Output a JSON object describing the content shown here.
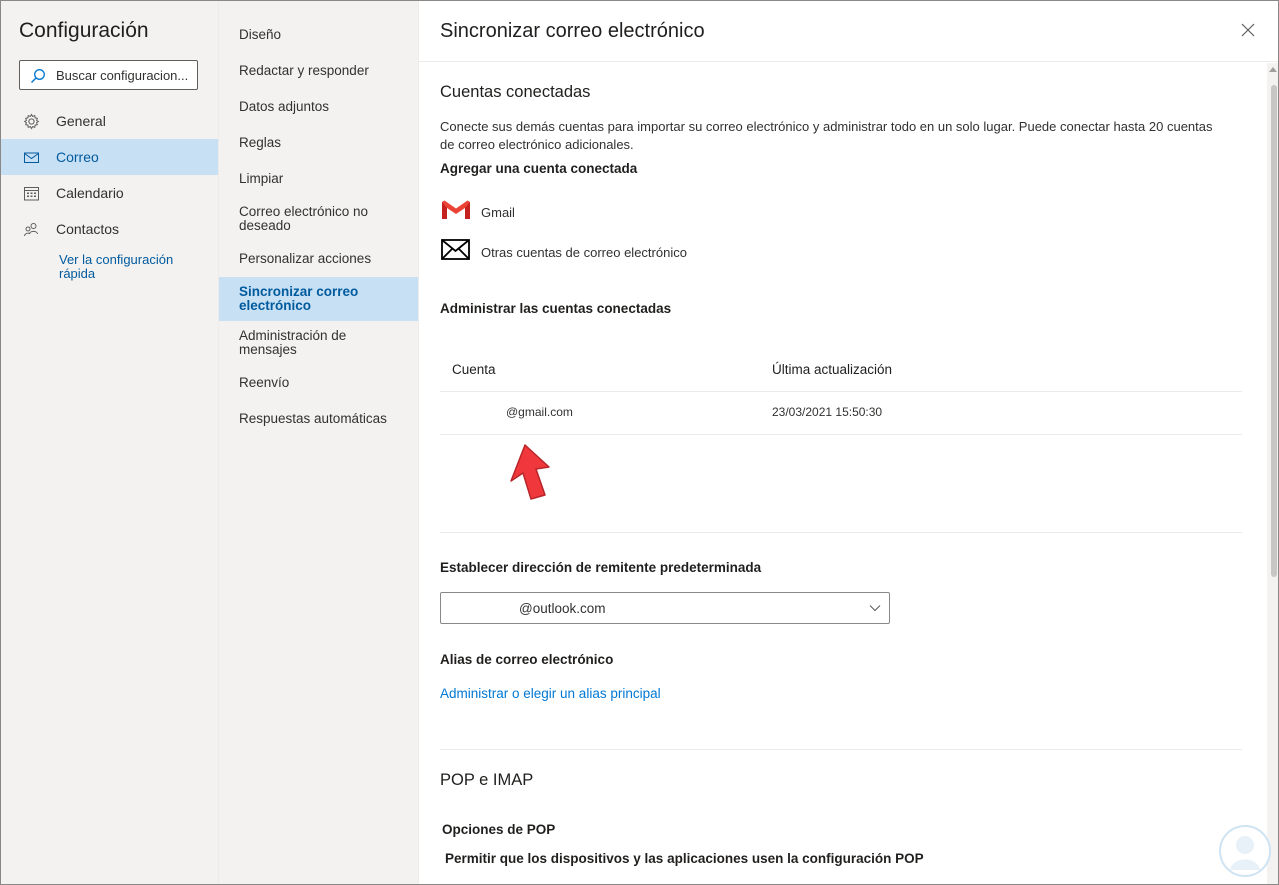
{
  "nav": {
    "title": "Configuración",
    "search_placeholder": "Buscar configuracion...",
    "items": [
      {
        "label": "General",
        "icon": "gear-icon"
      },
      {
        "label": "Correo",
        "icon": "mail-icon",
        "active": true
      },
      {
        "label": "Calendario",
        "icon": "calendar-icon"
      },
      {
        "label": "Contactos",
        "icon": "people-icon"
      }
    ],
    "quick_link": "Ver la configuración rápida"
  },
  "submenu": {
    "items": [
      "Diseño",
      "Redactar y responder",
      "Datos adjuntos",
      "Reglas",
      "Limpiar",
      "Correo electrónico no deseado",
      "Personalizar acciones",
      "Sincronizar correo electrónico",
      "Administración de mensajes",
      "Reenvío",
      "Respuestas automáticas"
    ],
    "active_index": 7
  },
  "panel": {
    "title": "Sincronizar correo electrónico",
    "connected": {
      "heading": "Cuentas conectadas",
      "description": "Conecte sus demás cuentas para importar su correo electrónico y administrar todo en un solo lugar. Puede conectar hasta 20 cuentas de correo electrónico adicionales.",
      "add_label": "Agregar una cuenta conectada",
      "gmail_label": "Gmail",
      "other_label": "Otras cuentas de correo electrónico",
      "manage_label": "Administrar las cuentas conectadas",
      "col_account": "Cuenta",
      "col_updated": "Última actualización",
      "rows": [
        {
          "account": "@gmail.com",
          "updated": "23/03/2021 15:50:30"
        }
      ]
    },
    "sender": {
      "label": "Establecer dirección de remitente predeterminada",
      "value": "@outlook.com"
    },
    "alias": {
      "label": "Alias de correo electrónico",
      "link": "Administrar o elegir un alias principal"
    },
    "pop": {
      "heading": "POP e IMAP",
      "options_label": "Opciones de POP",
      "allow_label": "Permitir que los dispositivos y las aplicaciones usen la configuración POP"
    }
  },
  "colors": {
    "accent": "#0078d4",
    "active_bg": "#c7e0f4",
    "nav_bg": "#f3f2f1",
    "annotation_arrow": "#f0373c"
  }
}
